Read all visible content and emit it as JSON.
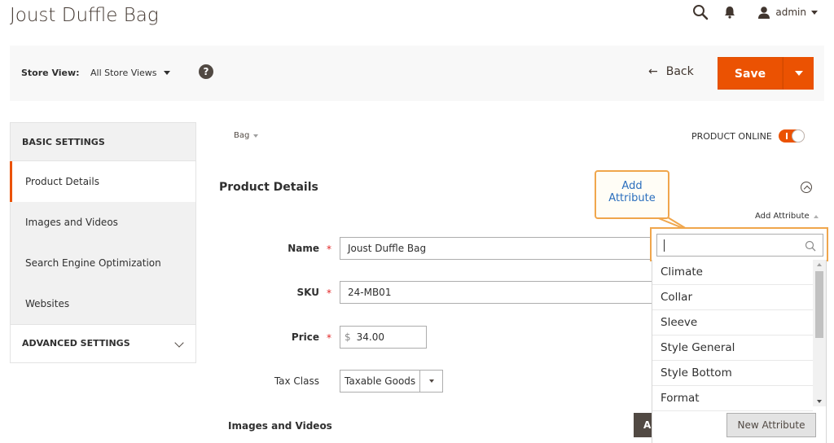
{
  "page": {
    "title": "Joust Duffle Bag"
  },
  "header": {
    "user_label": "admin"
  },
  "toolbar": {
    "store_view_label": "Store View:",
    "store_view_value": "All Store Views",
    "help_label": "?",
    "back_label": "Back",
    "save_label": "Save",
    "accent_color": "#eb5202"
  },
  "sidebar": {
    "basic_settings": "BASIC SETTINGS",
    "items": [
      {
        "label": "Product Details",
        "active": true
      },
      {
        "label": "Images and Videos",
        "active": false
      },
      {
        "label": "Search Engine Optimization",
        "active": false
      },
      {
        "label": "Websites",
        "active": false
      }
    ],
    "advanced_settings": "ADVANCED SETTINGS"
  },
  "product": {
    "attribute_set": "Bag",
    "online_label": "PRODUCT ONLINE",
    "online": true,
    "section_title": "Product Details",
    "add_attribute_link": "Add Attribute"
  },
  "callout": {
    "line1": "Add",
    "line2": "Attribute"
  },
  "form": {
    "name_label": "Name",
    "name_value": "Joust Duffle Bag",
    "sku_label": "SKU",
    "sku_value": "24-MB01",
    "price_label": "Price",
    "price_currency": "$",
    "price_value": "34.00",
    "tax_label": "Tax Class",
    "tax_value": "Taxable Goods",
    "required_mark": "*",
    "images_label": "Images and Videos",
    "dark_button_partial": "A"
  },
  "attribute_dropdown": {
    "search_value": "",
    "options": [
      "Climate",
      "Collar",
      "Sleeve",
      "Style General",
      "Style Bottom",
      "Format"
    ],
    "new_attribute_label": "New Attribute"
  },
  "icons": {
    "search": "search-icon",
    "notifications": "bell-icon",
    "user": "user-icon",
    "help": "help-icon",
    "back": "arrow-left-icon",
    "collapse": "chevron-up-circle-icon"
  }
}
